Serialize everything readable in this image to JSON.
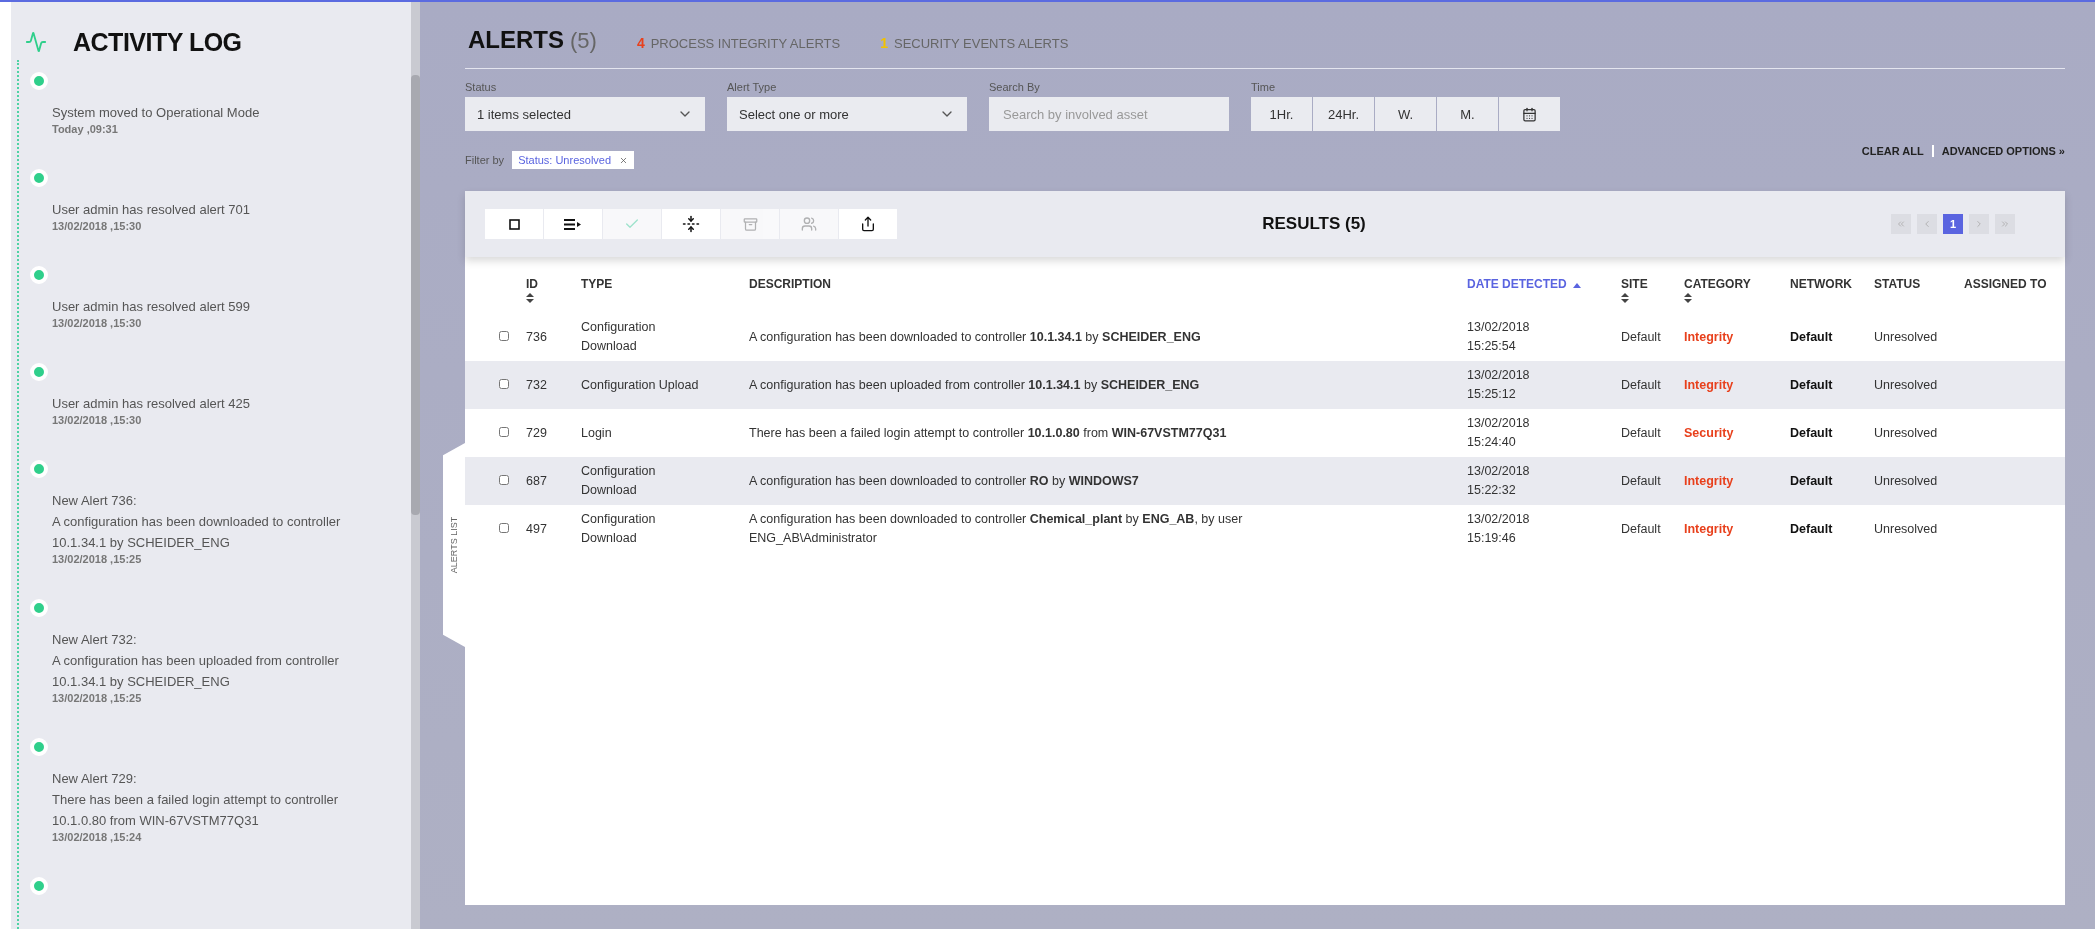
{
  "activity_log": {
    "title": "ACTIVITY LOG",
    "items": [
      {
        "kind": "entry",
        "text": "System moved to Operational Mode",
        "time": "Today ,09:31"
      },
      {
        "kind": "entry",
        "text": "User admin has resolved alert 701",
        "time": "13/02/2018 ,15:30"
      },
      {
        "kind": "entry",
        "text": "User admin has resolved alert 599",
        "time": "13/02/2018 ,15:30"
      },
      {
        "kind": "entry",
        "text": "User admin has resolved alert 425",
        "time": "13/02/2018 ,15:30"
      },
      {
        "kind": "entry",
        "text": "New Alert 736:\nA configuration has been downloaded to controller\n10.1.34.1 by SCHEIDER_ENG",
        "time": "13/02/2018 ,15:25"
      },
      {
        "kind": "entry",
        "text": "New Alert 732:\nA configuration has been uploaded from controller\n10.1.34.1 by SCHEIDER_ENG",
        "time": "13/02/2018 ,15:25"
      },
      {
        "kind": "entry",
        "text": "New Alert 729:\nThere has been a failed login attempt to controller\n10.1.0.80 from WIN-67VSTM77Q31",
        "time": "13/02/2018 ,15:24"
      },
      {
        "kind": "marker"
      }
    ]
  },
  "header": {
    "title": "ALERTS",
    "count": "(5)",
    "summary": [
      {
        "count": "4",
        "label": "PROCESS INTEGRITY ALERTS",
        "color": "#e8401c"
      },
      {
        "count": "1",
        "label": "SECURITY EVENTS ALERTS",
        "color": "#f2c200"
      }
    ]
  },
  "filters": {
    "status": {
      "label": "Status",
      "value": "1 items selected"
    },
    "alert_type": {
      "label": "Alert Type",
      "placeholder": "Select one or more"
    },
    "search": {
      "label": "Search By",
      "placeholder": "Search by involved asset"
    },
    "time": {
      "label": "Time",
      "options": [
        {
          "kind": "text",
          "label": "1Hr.",
          "selected": false
        },
        {
          "kind": "text",
          "label": "24Hr.",
          "selected": false
        },
        {
          "kind": "text",
          "label": "W.",
          "selected": false
        },
        {
          "kind": "text",
          "label": "M.",
          "selected": false
        },
        {
          "kind": "calendar",
          "selected": false
        }
      ]
    }
  },
  "active_filters": {
    "label": "Filter by",
    "chips": [
      "Status: Unresolved"
    ],
    "clear_all": "CLEAR ALL",
    "advanced": "ADVANCED OPTIONS »"
  },
  "results": {
    "title": "RESULTS (5)",
    "side_tab": "ALERTS LIST",
    "tools": [
      {
        "kind": "select",
        "disabled": false
      },
      {
        "kind": "list",
        "disabled": false
      },
      {
        "kind": "check",
        "disabled": true
      },
      {
        "kind": "collapse",
        "disabled": false
      },
      {
        "kind": "archive",
        "disabled": true
      },
      {
        "kind": "users",
        "disabled": true
      },
      {
        "kind": "export",
        "disabled": false
      }
    ],
    "pagination": {
      "nav": [
        {
          "kind": "first",
          "disabled": true
        },
        {
          "kind": "prev",
          "disabled": true
        },
        {
          "kind": "next",
          "disabled": true
        },
        {
          "kind": "last",
          "disabled": true
        }
      ],
      "pages": [
        {
          "label": "1",
          "selected": true
        }
      ]
    },
    "columns": [
      {
        "label": "ID",
        "sortable": true,
        "sorted": false
      },
      {
        "label": "TYPE",
        "sortable": false,
        "sorted": false
      },
      {
        "label": "DESCRIPTION",
        "sortable": false,
        "sorted": false
      },
      {
        "label": "DATE DETECTED",
        "sorted": true
      },
      {
        "label": "SITE",
        "sortable": true,
        "sorted": false
      },
      {
        "label": "CATEGORY",
        "sortable": true,
        "sorted": false
      },
      {
        "label": "NETWORK",
        "sortable": false,
        "sorted": false
      },
      {
        "label": "STATUS",
        "sortable": false,
        "sorted": false
      },
      {
        "label": "ASSIGNED TO",
        "sortable": false,
        "sorted": false
      }
    ],
    "rows": [
      {
        "checked": false,
        "id": "736",
        "type": "Configuration\nDownload",
        "description": "A configuration has been downloaded to controller **10.1.34.1** by **SCHEIDER_ENG**",
        "date_detected": "13/02/2018\n15:25:54",
        "site": "Default",
        "category": "Integrity",
        "network": "Default",
        "status": "Unresolved"
      },
      {
        "checked": false,
        "id": "732",
        "type": "Configuration Upload",
        "description": "A configuration has been uploaded from controller **10.1.34.1** by **SCHEIDER_ENG**",
        "date_detected": "13/02/2018\n15:25:12",
        "site": "Default",
        "category": "Integrity",
        "network": "Default",
        "status": "Unresolved"
      },
      {
        "checked": false,
        "id": "729",
        "type": "Login",
        "description": "There has been a failed login attempt to controller **10.1.0.80** from **WIN-67VSTM77Q31**",
        "date_detected": "13/02/2018\n15:24:40",
        "site": "Default",
        "category": "Security",
        "network": "Default",
        "status": "Unresolved"
      },
      {
        "checked": false,
        "id": "687",
        "type": "Configuration\nDownload",
        "description": "A configuration has been downloaded to controller **RO** by **WINDOWS7**",
        "date_detected": "13/02/2018\n15:22:32",
        "site": "Default",
        "category": "Integrity",
        "network": "Default",
        "status": "Unresolved"
      },
      {
        "checked": false,
        "id": "497",
        "type": "Configuration\nDownload",
        "description": "A configuration has been downloaded to controller **Chemical_plant** by **ENG_AB**, by user\nENG_AB\\Administrator",
        "date_detected": "13/02/2018\n15:19:46",
        "site": "Default",
        "category": "Integrity",
        "network": "Default",
        "status": "Unresolved"
      }
    ]
  }
}
